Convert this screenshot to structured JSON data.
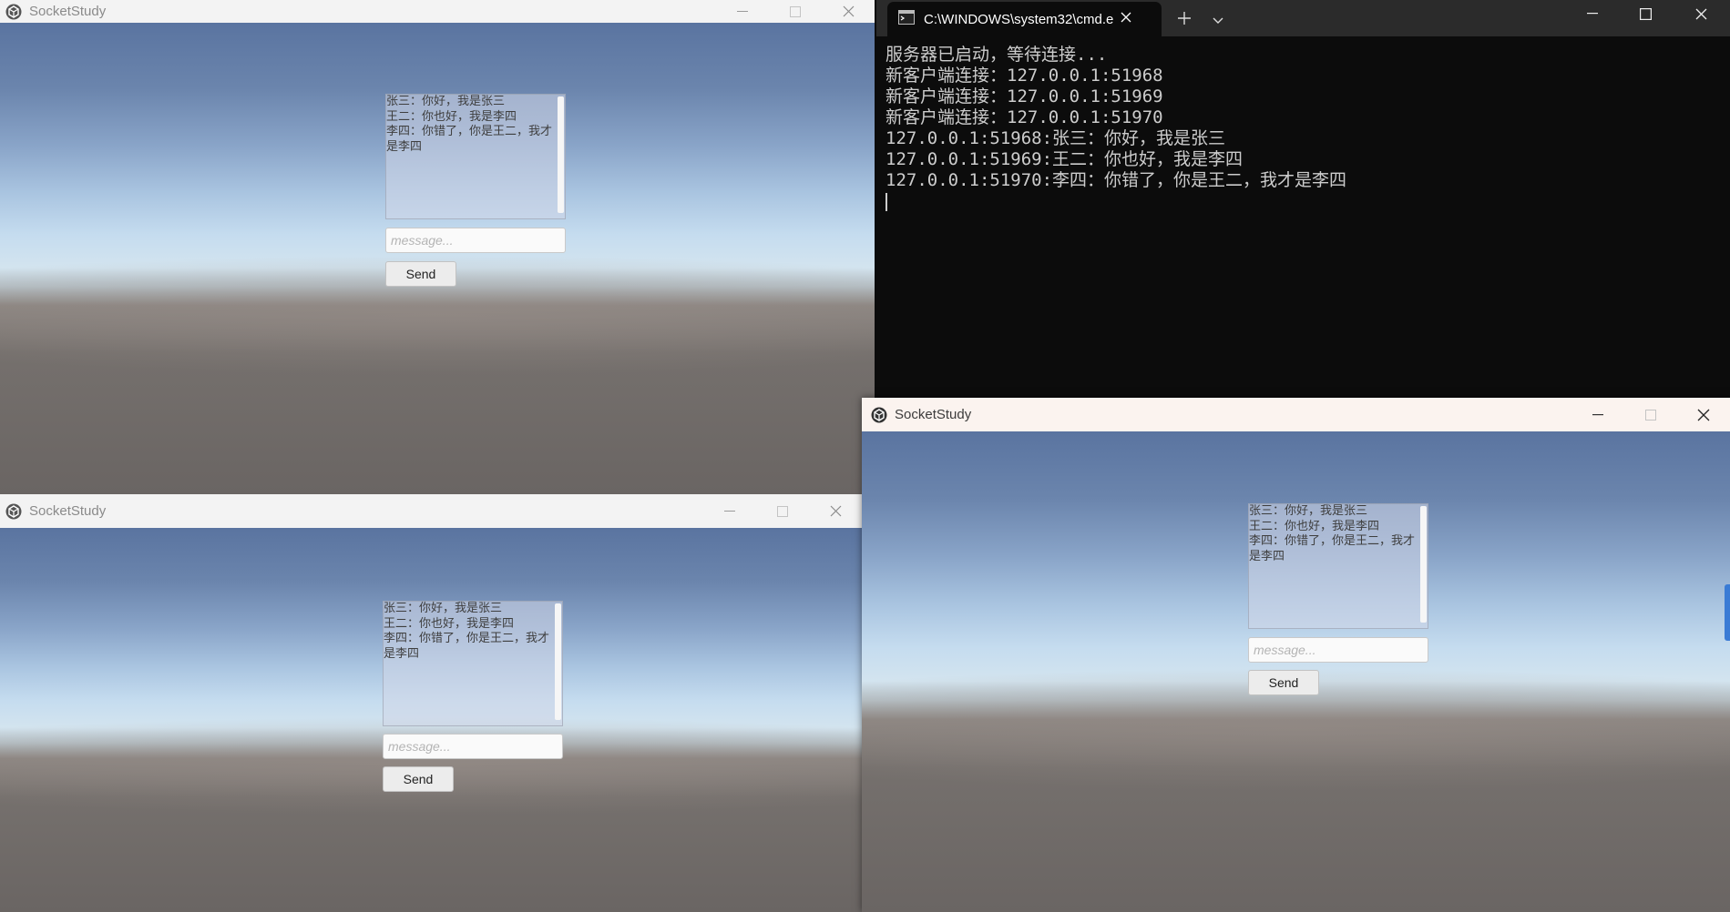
{
  "windows": {
    "top_left": {
      "title": "SocketStudy",
      "chat_log": "张三：你好，我是张三\n王二：你也好，我是李四\n李四：你错了，你是王二，我才是李四",
      "input_placeholder": "message...",
      "send_label": "Send"
    },
    "bottom_left": {
      "title": "SocketStudy",
      "chat_log": "张三：你好，我是张三\n王二：你也好，我是李四\n李四：你错了，你是王二，我才是李四",
      "input_placeholder": "message...",
      "send_label": "Send"
    },
    "bottom_right": {
      "title": "SocketStudy",
      "chat_log": "张三：你好，我是张三\n王二：你也好，我是李四\n李四：你错了，你是王二，我才是李四",
      "input_placeholder": "message...",
      "send_label": "Send"
    }
  },
  "terminal": {
    "tab_title": "C:\\WINDOWS\\system32\\cmd.e",
    "lines": [
      "服务器已启动，等待连接...",
      "新客户端连接：127.0.0.1:51968",
      "新客户端连接：127.0.0.1:51969",
      "新客户端连接：127.0.0.1:51970",
      "127.0.0.1:51968:张三：你好，我是张三",
      "127.0.0.1:51969:王二：你也好，我是李四",
      "127.0.0.1:51970:李四：你错了，你是王二，我才是李四"
    ]
  },
  "icons": {
    "app_icon": "unity-logo-icon",
    "terminal_icon": "terminal-icon",
    "new_tab": "plus-icon",
    "tab_dropdown": "chevron-down-icon",
    "minimize": "minimize-icon",
    "maximize": "maximize-icon",
    "close": "close-icon"
  }
}
